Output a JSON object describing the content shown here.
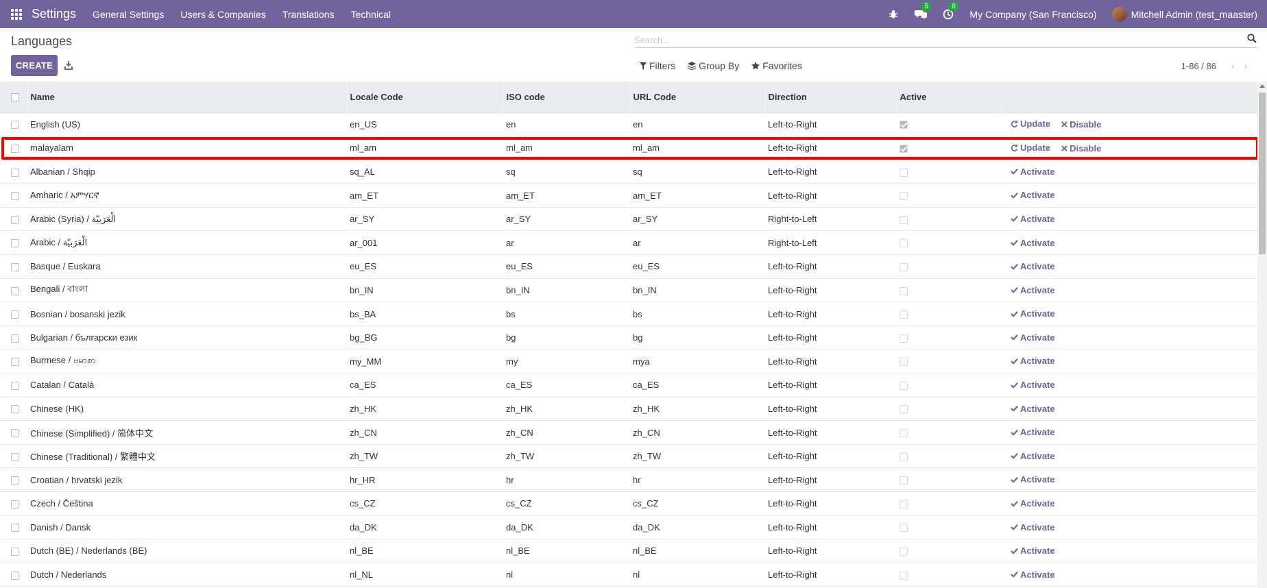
{
  "navbar": {
    "app_title": "Settings",
    "menu": [
      "General Settings",
      "Users & Companies",
      "Translations",
      "Technical"
    ],
    "messages_badge": "5",
    "activities_badge": "6",
    "company": "My Company (San Francisco)",
    "user": "Mitchell Admin (test_maaster)"
  },
  "control": {
    "page_title": "Languages",
    "create_label": "CREATE",
    "search_placeholder": "Search...",
    "filters_label": "Filters",
    "groupby_label": "Group By",
    "favorites_label": "Favorites",
    "pager": "1-86 / 86"
  },
  "table": {
    "columns": [
      "Name",
      "Locale Code",
      "ISO code",
      "URL Code",
      "Direction",
      "Active"
    ],
    "rows": [
      {
        "name": "English (US)",
        "locale": "en_US",
        "iso": "en",
        "url": "en",
        "direction": "Left-to-Right",
        "active": true
      },
      {
        "name": "malayalam",
        "locale": "ml_am",
        "iso": "ml_am",
        "url": "ml_am",
        "direction": "Left-to-Right",
        "active": true
      },
      {
        "name": "Albanian / Shqip",
        "locale": "sq_AL",
        "iso": "sq",
        "url": "sq",
        "direction": "Left-to-Right",
        "active": false
      },
      {
        "name": "Amharic / አምሃርኛ",
        "locale": "am_ET",
        "iso": "am_ET",
        "url": "am_ET",
        "direction": "Left-to-Right",
        "active": false
      },
      {
        "name": "Arabic (Syria) / الْعَرَبيّة",
        "locale": "ar_SY",
        "iso": "ar_SY",
        "url": "ar_SY",
        "direction": "Right-to-Left",
        "active": false
      },
      {
        "name": "Arabic / الْعَرَبيّة",
        "locale": "ar_001",
        "iso": "ar",
        "url": "ar",
        "direction": "Right-to-Left",
        "active": false
      },
      {
        "name": "Basque / Euskara",
        "locale": "eu_ES",
        "iso": "eu_ES",
        "url": "eu_ES",
        "direction": "Left-to-Right",
        "active": false
      },
      {
        "name": "Bengali / বাংলা",
        "locale": "bn_IN",
        "iso": "bn_IN",
        "url": "bn_IN",
        "direction": "Left-to-Right",
        "active": false
      },
      {
        "name": "Bosnian / bosanski jezik",
        "locale": "bs_BA",
        "iso": "bs",
        "url": "bs",
        "direction": "Left-to-Right",
        "active": false
      },
      {
        "name": "Bulgarian / български език",
        "locale": "bg_BG",
        "iso": "bg",
        "url": "bg",
        "direction": "Left-to-Right",
        "active": false
      },
      {
        "name": "Burmese / ဗမာစာ",
        "locale": "my_MM",
        "iso": "my",
        "url": "mya",
        "direction": "Left-to-Right",
        "active": false
      },
      {
        "name": "Catalan / Català",
        "locale": "ca_ES",
        "iso": "ca_ES",
        "url": "ca_ES",
        "direction": "Left-to-Right",
        "active": false
      },
      {
        "name": "Chinese (HK)",
        "locale": "zh_HK",
        "iso": "zh_HK",
        "url": "zh_HK",
        "direction": "Left-to-Right",
        "active": false
      },
      {
        "name": "Chinese (Simplified) / 简体中文",
        "locale": "zh_CN",
        "iso": "zh_CN",
        "url": "zh_CN",
        "direction": "Left-to-Right",
        "active": false
      },
      {
        "name": "Chinese (Traditional) / 繁體中文",
        "locale": "zh_TW",
        "iso": "zh_TW",
        "url": "zh_TW",
        "direction": "Left-to-Right",
        "active": false
      },
      {
        "name": "Croatian / hrvatski jezik",
        "locale": "hr_HR",
        "iso": "hr",
        "url": "hr",
        "direction": "Left-to-Right",
        "active": false
      },
      {
        "name": "Czech / Čeština",
        "locale": "cs_CZ",
        "iso": "cs_CZ",
        "url": "cs_CZ",
        "direction": "Left-to-Right",
        "active": false
      },
      {
        "name": "Danish / Dansk",
        "locale": "da_DK",
        "iso": "da_DK",
        "url": "da_DK",
        "direction": "Left-to-Right",
        "active": false
      },
      {
        "name": "Dutch (BE) / Nederlands (BE)",
        "locale": "nl_BE",
        "iso": "nl_BE",
        "url": "nl_BE",
        "direction": "Left-to-Right",
        "active": false
      },
      {
        "name": "Dutch / Nederlands",
        "locale": "nl_NL",
        "iso": "nl",
        "url": "nl",
        "direction": "Left-to-Right",
        "active": false
      }
    ],
    "actions": {
      "update": "Update",
      "disable": "Disable",
      "activate": "Activate"
    }
  }
}
